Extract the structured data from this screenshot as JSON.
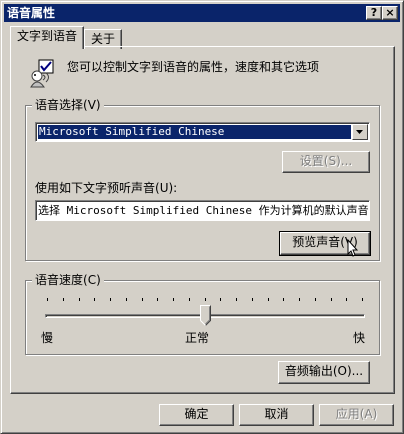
{
  "window": {
    "title": "语音属性",
    "help_button": "?",
    "close_button": "×"
  },
  "tabs": [
    {
      "label": "文字到语音",
      "active": true
    },
    {
      "label": "关于",
      "active": false
    }
  ],
  "intro": {
    "text": "您可以控制文字到语音的属性，速度和其它选项"
  },
  "voice_selection": {
    "legend": "语音选择",
    "legend_key": "(V)",
    "selected_voice": "Microsoft Simplified Chinese",
    "settings_button": "设置(S)...",
    "preview_label": "使用如下文字预听声音",
    "preview_key": "(U):",
    "preview_text": "选择 Microsoft Simplified Chinese 作为计算机的默认声音",
    "preview_button": "预览声音(V)"
  },
  "voice_speed": {
    "legend": "语音速度",
    "legend_key": "(C)",
    "slow_label": "慢",
    "normal_label": "正常",
    "fast_label": "快",
    "value_fraction": 0.5
  },
  "audio_output_button": "音频输出(O)...",
  "footer": {
    "ok": "确定",
    "cancel": "取消",
    "apply": "应用(A)"
  },
  "colors": {
    "titlebar": "#0a246a",
    "face": "#d4d0c8",
    "selection": "#0a246a"
  }
}
